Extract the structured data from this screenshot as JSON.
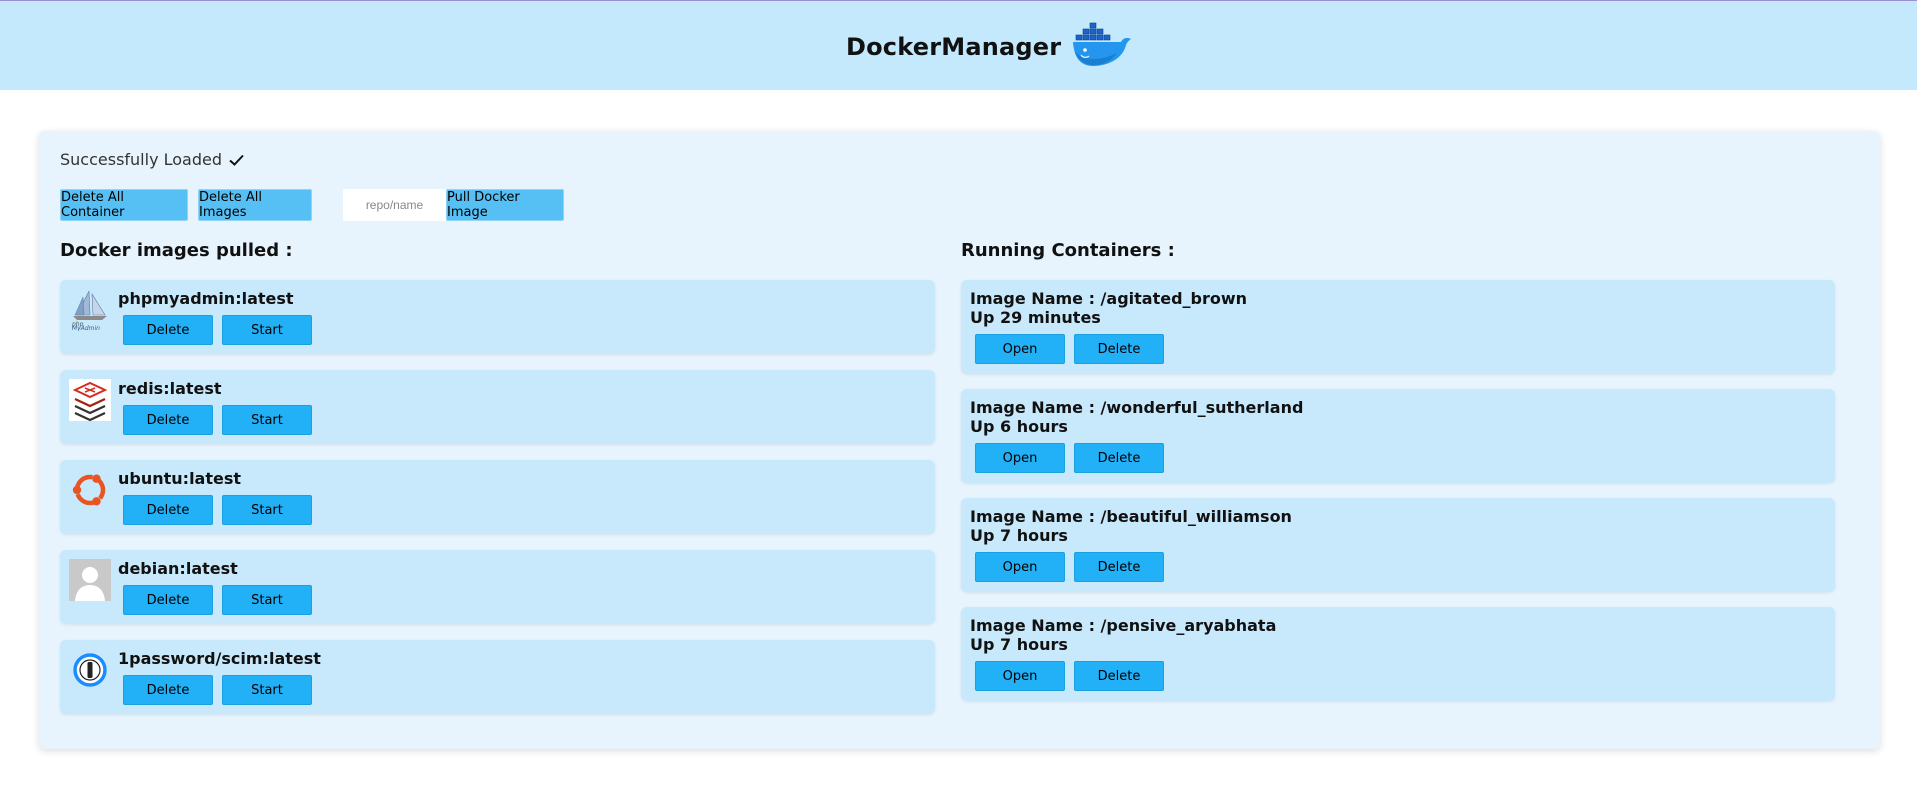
{
  "header": {
    "title": "DockerManager",
    "logo_icon": "docker-whale-icon",
    "bg_color": "#c4e9fc"
  },
  "status": {
    "text": "Successfully Loaded",
    "icon": "checkmark-icon"
  },
  "toolbar": {
    "delete_all_containers_label": "Delete All Container",
    "delete_all_images_label": "Delete All Images",
    "pull_input_placeholder": "repo/name",
    "pull_input_value": "",
    "pull_button_label": "Pull Docker Image"
  },
  "images_section": {
    "title": "Docker images pulled :",
    "items": [
      {
        "name": "phpmyadmin:latest",
        "icon": "phpmyadmin-sailboat-icon",
        "delete_label": "Delete",
        "start_label": "Start"
      },
      {
        "name": "redis:latest",
        "icon": "redis-stack-icon",
        "delete_label": "Delete",
        "start_label": "Start"
      },
      {
        "name": "ubuntu:latest",
        "icon": "ubuntu-circle-icon",
        "delete_label": "Delete",
        "start_label": "Start"
      },
      {
        "name": "debian:latest",
        "icon": "default-avatar-icon",
        "delete_label": "Delete",
        "start_label": "Start"
      },
      {
        "name": "1password/scim:latest",
        "icon": "1password-keyhole-icon",
        "delete_label": "Delete",
        "start_label": "Start"
      }
    ]
  },
  "containers_section": {
    "title": "Running Containers :",
    "items": [
      {
        "name": "Image Name : /agitated_brown",
        "uptime": "Up 29 minutes",
        "open_label": "Open",
        "delete_label": "Delete"
      },
      {
        "name": "Image Name : /wonderful_sutherland",
        "uptime": "Up 6 hours",
        "open_label": "Open",
        "delete_label": "Delete"
      },
      {
        "name": "Image Name : /beautiful_williamson",
        "uptime": "Up 7 hours",
        "open_label": "Open",
        "delete_label": "Delete"
      },
      {
        "name": "Image Name : /pensive_aryabhata",
        "uptime": "Up 7 hours",
        "open_label": "Open",
        "delete_label": "Delete"
      }
    ]
  },
  "colors": {
    "panel_bg": "#e7f4fd",
    "card_bg": "#c7e9fb",
    "action_button": "#22b0f7",
    "toolbar_button": "#56c0f5"
  }
}
